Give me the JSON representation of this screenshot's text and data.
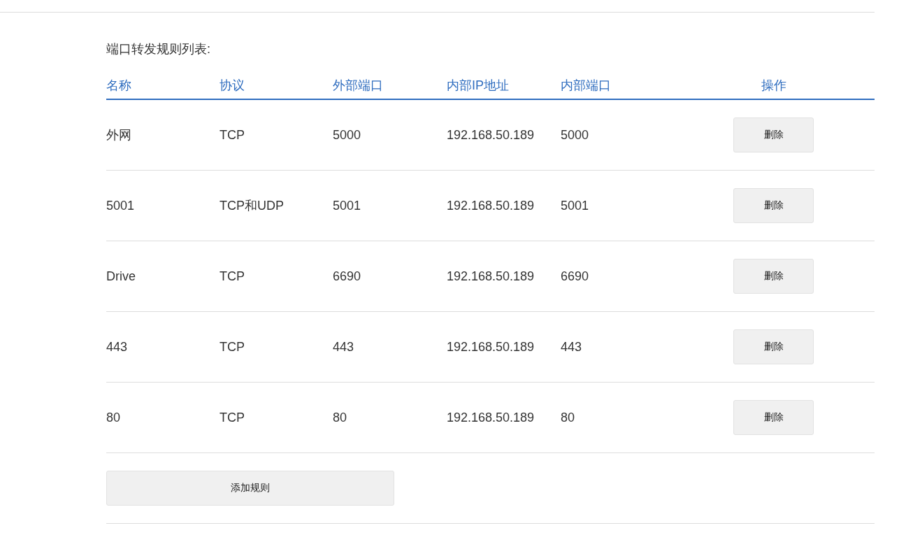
{
  "title": "端口转发规则列表:",
  "table": {
    "columns": [
      "名称",
      "协议",
      "外部端口",
      "内部IP地址",
      "内部端口",
      "操作"
    ],
    "rows": [
      {
        "name": "外网",
        "protocol": "TCP",
        "external_port": "5000",
        "internal_ip": "192.168.50.189",
        "internal_port": "5000",
        "action": "删除"
      },
      {
        "name": "5001",
        "protocol": "TCP和UDP",
        "external_port": "5001",
        "internal_ip": "192.168.50.189",
        "internal_port": "5001",
        "action": "删除"
      },
      {
        "name": "Drive",
        "protocol": "TCP",
        "external_port": "6690",
        "internal_ip": "192.168.50.189",
        "internal_port": "6690",
        "action": "删除"
      },
      {
        "name": "443",
        "protocol": "TCP",
        "external_port": "443",
        "internal_ip": "192.168.50.189",
        "internal_port": "443",
        "action": "删除"
      },
      {
        "name": "80",
        "protocol": "TCP",
        "external_port": "80",
        "internal_ip": "192.168.50.189",
        "internal_port": "80",
        "action": "删除"
      }
    ]
  },
  "add_button": "添加规则"
}
